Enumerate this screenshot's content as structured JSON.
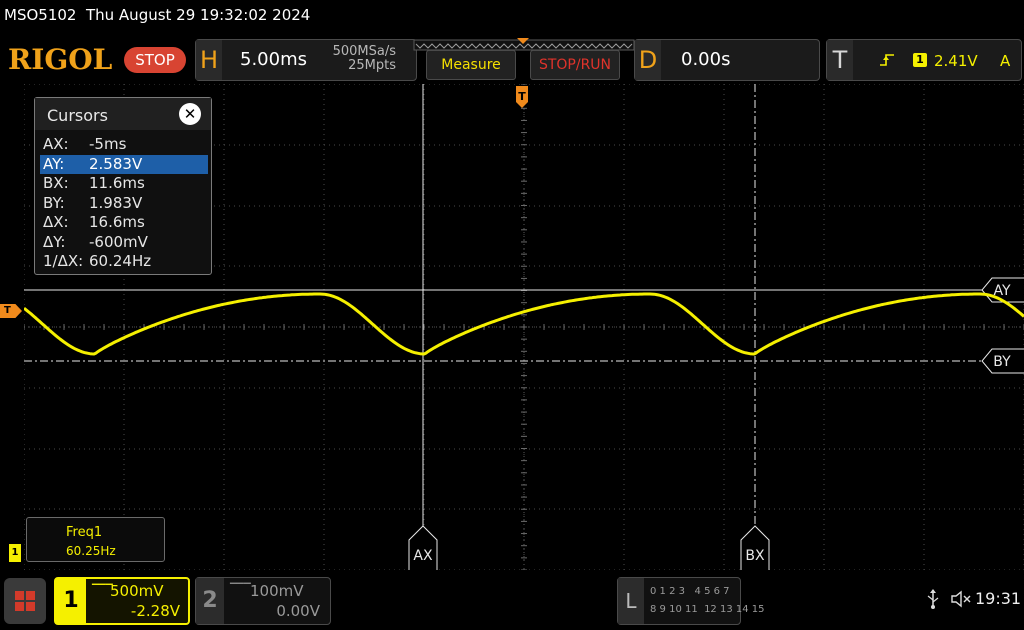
{
  "title_bar": {
    "text": "MSO5102  Thu August 29 19:32:02 2024"
  },
  "top_bar": {
    "logo": "RIGOL",
    "run_state": "STOP",
    "horizontal": {
      "letter": "H",
      "timebase": "5.00ms",
      "sample_rate": "500MSa/s",
      "memory_depth": "25Mpts"
    },
    "measure_label": "Measure",
    "stop_run_label": "STOP/RUN",
    "delay": {
      "letter": "D",
      "value": "0.00s"
    },
    "trigger": {
      "letter": "T",
      "source": "1",
      "level": "2.41V",
      "mode": "A"
    }
  },
  "cursors": {
    "title": "Cursors",
    "close": "✕",
    "rows": [
      {
        "key": "AX:",
        "value": "-5ms"
      },
      {
        "key": "AY:",
        "value": "2.583V"
      },
      {
        "key": "BX:",
        "value": "11.6ms"
      },
      {
        "key": "BY:",
        "value": "1.983V"
      },
      {
        "key": "ΔX:",
        "value": "16.6ms"
      },
      {
        "key": "ΔY:",
        "value": "-600mV"
      },
      {
        "key": "1/ΔX:",
        "value": "60.24Hz"
      }
    ],
    "selected_row": "AY:"
  },
  "markers": {
    "trigger_level": "T",
    "trigger_position": "T",
    "cursor_ay": "AY",
    "cursor_by": "BY",
    "cursor_ax": "AX",
    "cursor_bx": "BX",
    "channel_ground": "1"
  },
  "freq_measure": {
    "label": "Freq1",
    "value": "60.25Hz"
  },
  "bottom_bar": {
    "menu_icon": "grid-menu-icon",
    "channel1": {
      "number": "1",
      "scale": "500mV",
      "offset": "-2.28V",
      "color": "#f5f000"
    },
    "channel2": {
      "number": "2",
      "scale": "100mV",
      "offset": "0.00V"
    },
    "logic": {
      "letter": "L",
      "row1": "0 1 2 3   4 5 6 7",
      "row2": "8 9 10 11  12 13 14 15"
    },
    "usb_icon": "usb-icon",
    "speaker_icon": "speaker-muted-icon",
    "clock": "19:31"
  },
  "colors": {
    "trace": "#f5f000",
    "logo": "#f0a21a",
    "stop_badge": "#d84432",
    "stop_run_text": "#e0332b",
    "trigger_marker": "#f08a1c",
    "selected_row": "#1e5fa8"
  }
}
